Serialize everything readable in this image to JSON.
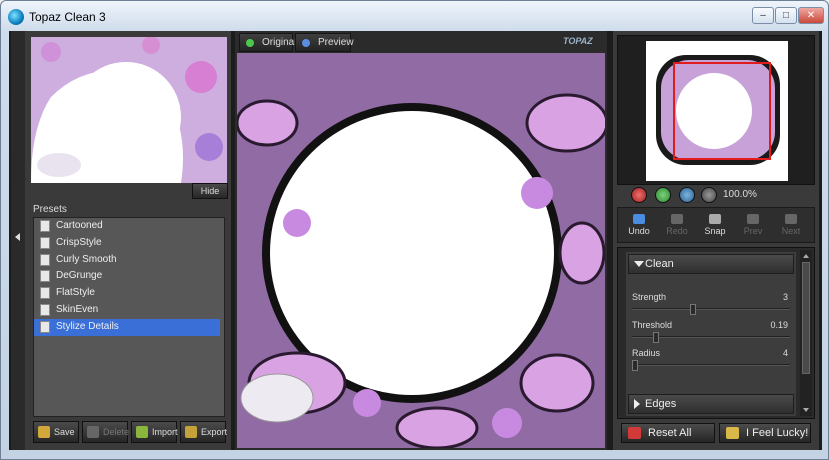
{
  "window": {
    "title": "Topaz Clean 3"
  },
  "left": {
    "hide_label": "Hide",
    "presets_label": "Presets",
    "presets": [
      "Cartooned",
      "CrispStyle",
      "Curly Smooth",
      "DeGrunge",
      "FlatStyle",
      "SkinEven",
      "Stylize Details"
    ],
    "selected_index": 6,
    "buttons": {
      "save": "Save",
      "delete": "Delete",
      "import": "Import",
      "export": "Export"
    }
  },
  "center": {
    "tabs": {
      "original": "Original",
      "preview": "Preview"
    },
    "logo": "TOPAZ"
  },
  "right": {
    "zoom": "100.0%",
    "zoom_buttons": {
      "zoom_out": "−",
      "zoom_in": "+",
      "fit": "FIT",
      "one_to_one": "1:1"
    },
    "tools": {
      "undo": "Undo",
      "redo": "Redo",
      "snap": "Snap",
      "prev": "Prev",
      "next": "Next"
    },
    "sections": {
      "clean": "Clean",
      "edges": "Edges"
    },
    "settings": [
      {
        "label": "Strength",
        "value": "3",
        "position": 0.38
      },
      {
        "label": "Threshold",
        "value": "0.19",
        "position": 0.14
      },
      {
        "label": "Radius",
        "value": "4",
        "position": 0.0
      }
    ],
    "reset_label": "Reset All",
    "lucky_label": "I Feel Lucky!"
  },
  "colors": {
    "selected": "#3a6fd8",
    "flower": "#c98ad6",
    "panel": "#3a3a3a"
  }
}
